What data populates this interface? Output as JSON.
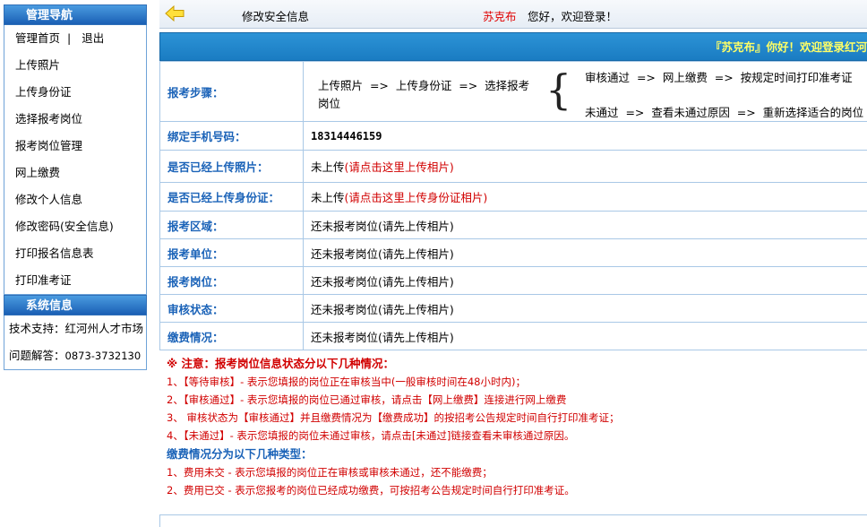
{
  "sidebar": {
    "nav_title": "管理导航",
    "home": "管理首页",
    "separator": "|",
    "logout": "退出",
    "items": [
      "上传照片",
      "上传身份证",
      "选择报考岗位",
      "报考岗位管理",
      "网上缴费",
      "修改个人信息",
      "修改密码(安全信息)",
      "打印报名信息表",
      "打印准考证"
    ],
    "sys_title": "系统信息",
    "support": "技术支持：红河州人才市场",
    "helpline_label": "问题解答：",
    "helpline_number": "0873-3732130"
  },
  "topbar": {
    "back_icon": "left-arrow-icon",
    "title": "修改安全信息",
    "user": "苏克布",
    "greeting": "您好，欢迎登录！"
  },
  "banner": {
    "text": "『苏克布』你好！欢迎登录红河"
  },
  "table": {
    "steps_label": "报考步骤：",
    "steps_left_1": "上传照片  =>  上传身份证  =>  选择报考",
    "steps_left_2": "岗位",
    "steps_brace": "{",
    "steps_r1": "审核通过  =>  网上缴费  =>  按规定时间打印准考证",
    "steps_r2": "未通过  =>  查看未通过原因  =>  重新选择适合的岗位",
    "phone_label": "绑定手机号码：",
    "phone_value": "18314446159",
    "photo_label": "是否已经上传照片：",
    "photo_status": "未上传",
    "photo_link": "(请点击这里上传相片)",
    "id_label": "是否已经上传身份证：",
    "id_status": "未上传",
    "id_link": "(请点击这里上传身份证相片)",
    "area_label": "报考区域：",
    "area_value": "还未报考岗位(请先上传相片)",
    "unit_label": "报考单位：",
    "unit_value": "还未报考岗位(请先上传相片)",
    "post_label": "报考岗位：",
    "post_value": "还未报考岗位(请先上传相片)",
    "audit_label": "审核状态：",
    "audit_value": "还未报考岗位(请先上传相片)",
    "fee_label": "缴费情况：",
    "fee_value": "还未报考岗位(请先上传相片)"
  },
  "notes": {
    "head": "※ 注意：报考岗位信息状态分以下几种情况：",
    "n1": "1、【等待审核】- 表示您填报的岗位正在审核当中(一般审核时间在48小时内)；",
    "n2": "2、【审核通过】- 表示您填报的岗位已通过审核，请点击【网上缴费】连接进行网上缴费",
    "n3": "3、 审核状态为【审核通过】并且缴费情况为【缴费成功】的按招考公告规定时间自行打印准考证；",
    "n4": "4、【未通过】- 表示您填报的岗位未通过审核，请点击[未通过]链接查看未审核通过原因。",
    "fee_head": "缴费情况分为以下几种类型：",
    "f1": "1、费用未交 - 表示您填报的岗位正在审核或审核未通过，还不能缴费；",
    "f2": "2、费用已交 - 表示您报考的岗位已经成功缴费，可按招考公告规定时间自行打印准考证。"
  },
  "colors": {
    "nav_header": "#1a5fb4",
    "label_blue": "#1b63b8",
    "alert_red": "#d10000",
    "banner_text": "#ffff66"
  }
}
